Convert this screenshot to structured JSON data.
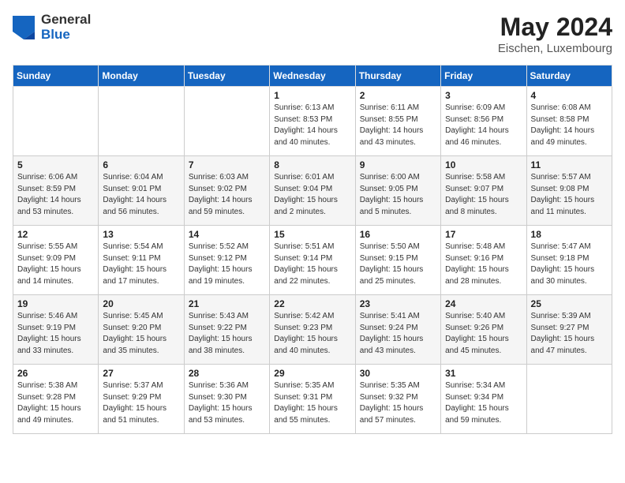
{
  "logo": {
    "general": "General",
    "blue": "Blue"
  },
  "title": "May 2024",
  "subtitle": "Eischen, Luxembourg",
  "days_header": [
    "Sunday",
    "Monday",
    "Tuesday",
    "Wednesday",
    "Thursday",
    "Friday",
    "Saturday"
  ],
  "weeks": [
    [
      {
        "day": "",
        "info": ""
      },
      {
        "day": "",
        "info": ""
      },
      {
        "day": "",
        "info": ""
      },
      {
        "day": "1",
        "info": "Sunrise: 6:13 AM\nSunset: 8:53 PM\nDaylight: 14 hours\nand 40 minutes."
      },
      {
        "day": "2",
        "info": "Sunrise: 6:11 AM\nSunset: 8:55 PM\nDaylight: 14 hours\nand 43 minutes."
      },
      {
        "day": "3",
        "info": "Sunrise: 6:09 AM\nSunset: 8:56 PM\nDaylight: 14 hours\nand 46 minutes."
      },
      {
        "day": "4",
        "info": "Sunrise: 6:08 AM\nSunset: 8:58 PM\nDaylight: 14 hours\nand 49 minutes."
      }
    ],
    [
      {
        "day": "5",
        "info": "Sunrise: 6:06 AM\nSunset: 8:59 PM\nDaylight: 14 hours\nand 53 minutes."
      },
      {
        "day": "6",
        "info": "Sunrise: 6:04 AM\nSunset: 9:01 PM\nDaylight: 14 hours\nand 56 minutes."
      },
      {
        "day": "7",
        "info": "Sunrise: 6:03 AM\nSunset: 9:02 PM\nDaylight: 14 hours\nand 59 minutes."
      },
      {
        "day": "8",
        "info": "Sunrise: 6:01 AM\nSunset: 9:04 PM\nDaylight: 15 hours\nand 2 minutes."
      },
      {
        "day": "9",
        "info": "Sunrise: 6:00 AM\nSunset: 9:05 PM\nDaylight: 15 hours\nand 5 minutes."
      },
      {
        "day": "10",
        "info": "Sunrise: 5:58 AM\nSunset: 9:07 PM\nDaylight: 15 hours\nand 8 minutes."
      },
      {
        "day": "11",
        "info": "Sunrise: 5:57 AM\nSunset: 9:08 PM\nDaylight: 15 hours\nand 11 minutes."
      }
    ],
    [
      {
        "day": "12",
        "info": "Sunrise: 5:55 AM\nSunset: 9:09 PM\nDaylight: 15 hours\nand 14 minutes."
      },
      {
        "day": "13",
        "info": "Sunrise: 5:54 AM\nSunset: 9:11 PM\nDaylight: 15 hours\nand 17 minutes."
      },
      {
        "day": "14",
        "info": "Sunrise: 5:52 AM\nSunset: 9:12 PM\nDaylight: 15 hours\nand 19 minutes."
      },
      {
        "day": "15",
        "info": "Sunrise: 5:51 AM\nSunset: 9:14 PM\nDaylight: 15 hours\nand 22 minutes."
      },
      {
        "day": "16",
        "info": "Sunrise: 5:50 AM\nSunset: 9:15 PM\nDaylight: 15 hours\nand 25 minutes."
      },
      {
        "day": "17",
        "info": "Sunrise: 5:48 AM\nSunset: 9:16 PM\nDaylight: 15 hours\nand 28 minutes."
      },
      {
        "day": "18",
        "info": "Sunrise: 5:47 AM\nSunset: 9:18 PM\nDaylight: 15 hours\nand 30 minutes."
      }
    ],
    [
      {
        "day": "19",
        "info": "Sunrise: 5:46 AM\nSunset: 9:19 PM\nDaylight: 15 hours\nand 33 minutes."
      },
      {
        "day": "20",
        "info": "Sunrise: 5:45 AM\nSunset: 9:20 PM\nDaylight: 15 hours\nand 35 minutes."
      },
      {
        "day": "21",
        "info": "Sunrise: 5:43 AM\nSunset: 9:22 PM\nDaylight: 15 hours\nand 38 minutes."
      },
      {
        "day": "22",
        "info": "Sunrise: 5:42 AM\nSunset: 9:23 PM\nDaylight: 15 hours\nand 40 minutes."
      },
      {
        "day": "23",
        "info": "Sunrise: 5:41 AM\nSunset: 9:24 PM\nDaylight: 15 hours\nand 43 minutes."
      },
      {
        "day": "24",
        "info": "Sunrise: 5:40 AM\nSunset: 9:26 PM\nDaylight: 15 hours\nand 45 minutes."
      },
      {
        "day": "25",
        "info": "Sunrise: 5:39 AM\nSunset: 9:27 PM\nDaylight: 15 hours\nand 47 minutes."
      }
    ],
    [
      {
        "day": "26",
        "info": "Sunrise: 5:38 AM\nSunset: 9:28 PM\nDaylight: 15 hours\nand 49 minutes."
      },
      {
        "day": "27",
        "info": "Sunrise: 5:37 AM\nSunset: 9:29 PM\nDaylight: 15 hours\nand 51 minutes."
      },
      {
        "day": "28",
        "info": "Sunrise: 5:36 AM\nSunset: 9:30 PM\nDaylight: 15 hours\nand 53 minutes."
      },
      {
        "day": "29",
        "info": "Sunrise: 5:35 AM\nSunset: 9:31 PM\nDaylight: 15 hours\nand 55 minutes."
      },
      {
        "day": "30",
        "info": "Sunrise: 5:35 AM\nSunset: 9:32 PM\nDaylight: 15 hours\nand 57 minutes."
      },
      {
        "day": "31",
        "info": "Sunrise: 5:34 AM\nSunset: 9:34 PM\nDaylight: 15 hours\nand 59 minutes."
      },
      {
        "day": "",
        "info": ""
      }
    ]
  ]
}
